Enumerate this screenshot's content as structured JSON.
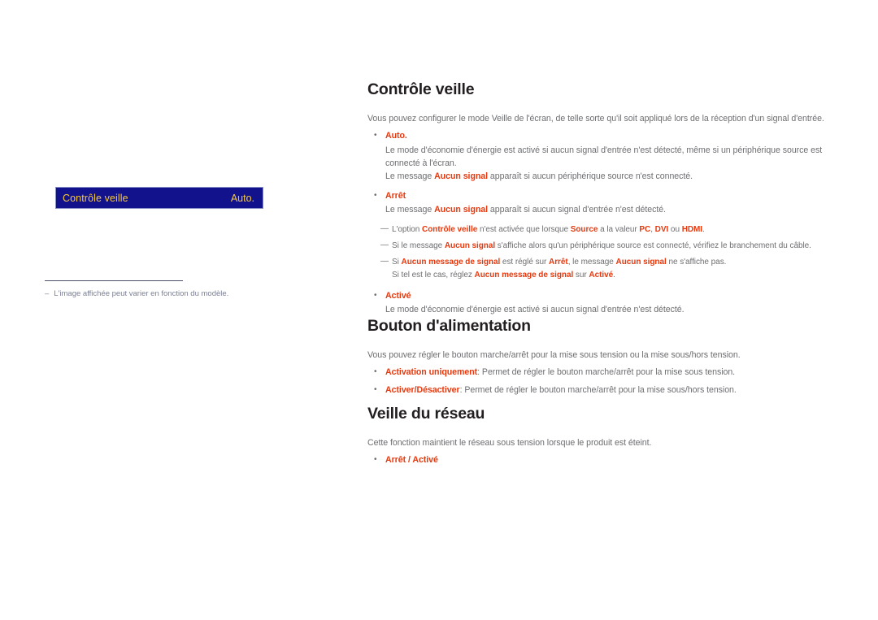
{
  "osd": {
    "label": "Contrôle veille",
    "value": "Auto.",
    "bg_color": "#12128c",
    "text_color": "#f5c842"
  },
  "footnote": {
    "dash": "‒",
    "text": "L'image affichée peut varier en fonction du modèle."
  },
  "colors": {
    "accent_red": "#e8380d",
    "body_gray": "#6d6e71",
    "heading_black": "#231f20"
  },
  "markers": {
    "bullet": "•",
    "note_dash": "—"
  },
  "sections": [
    {
      "title": "Contrôle veille",
      "intro": "Vous pouvez configurer le mode Veille de l'écran, de telle sorte qu'il soit appliqué lors de la réception d'un signal d'entrée.",
      "items": [
        {
          "label": "Auto.",
          "lines": [
            "Le mode d'économie d'énergie est activé si aucun signal d'entrée n'est détecté, même si un périphérique source est connecté à l'écran.",
            "Le message Aucun signal apparaît si aucun périphérique source n'est connecté."
          ]
        },
        {
          "label": "Arrêt",
          "lines": [
            "Le message Aucun signal apparaît si aucun signal d'entrée n'est détecté."
          ]
        },
        {
          "label": "Activé",
          "lines": [
            "Le mode d'économie d'énergie est activé si aucun signal d'entrée n'est détecté."
          ]
        }
      ],
      "notes": [
        "L'option Contrôle veille n'est activée que lorsque Source a la valeur PC, DVI ou HDMI.",
        "Si le message Aucun signal s'affiche alors qu'un périphérique source est connecté, vérifiez le branchement du câble.",
        "Si Aucun message de signal est réglé sur Arrêt, le message Aucun signal ne s'affiche pas.",
        "Si tel est le cas, réglez Aucun message de signal sur Activé."
      ]
    },
    {
      "title": "Bouton d'alimentation",
      "intro": "Vous pouvez régler le bouton marche/arrêt pour la mise sous tension ou la mise sous/hors tension.",
      "options": [
        {
          "label": "Activation uniquement",
          "desc": ": Permet de régler le bouton marche/arrêt pour la mise sous tension."
        },
        {
          "label": "Activer/Désactiver",
          "desc": ": Permet de régler le bouton marche/arrêt pour la mise sous/hors tension."
        }
      ]
    },
    {
      "title": "Veille du réseau",
      "intro": "Cette fonction maintient le réseau sous tension lorsque le produit est éteint.",
      "options": [
        {
          "label": "Arrêt / Activé",
          "desc": ""
        }
      ]
    }
  ]
}
